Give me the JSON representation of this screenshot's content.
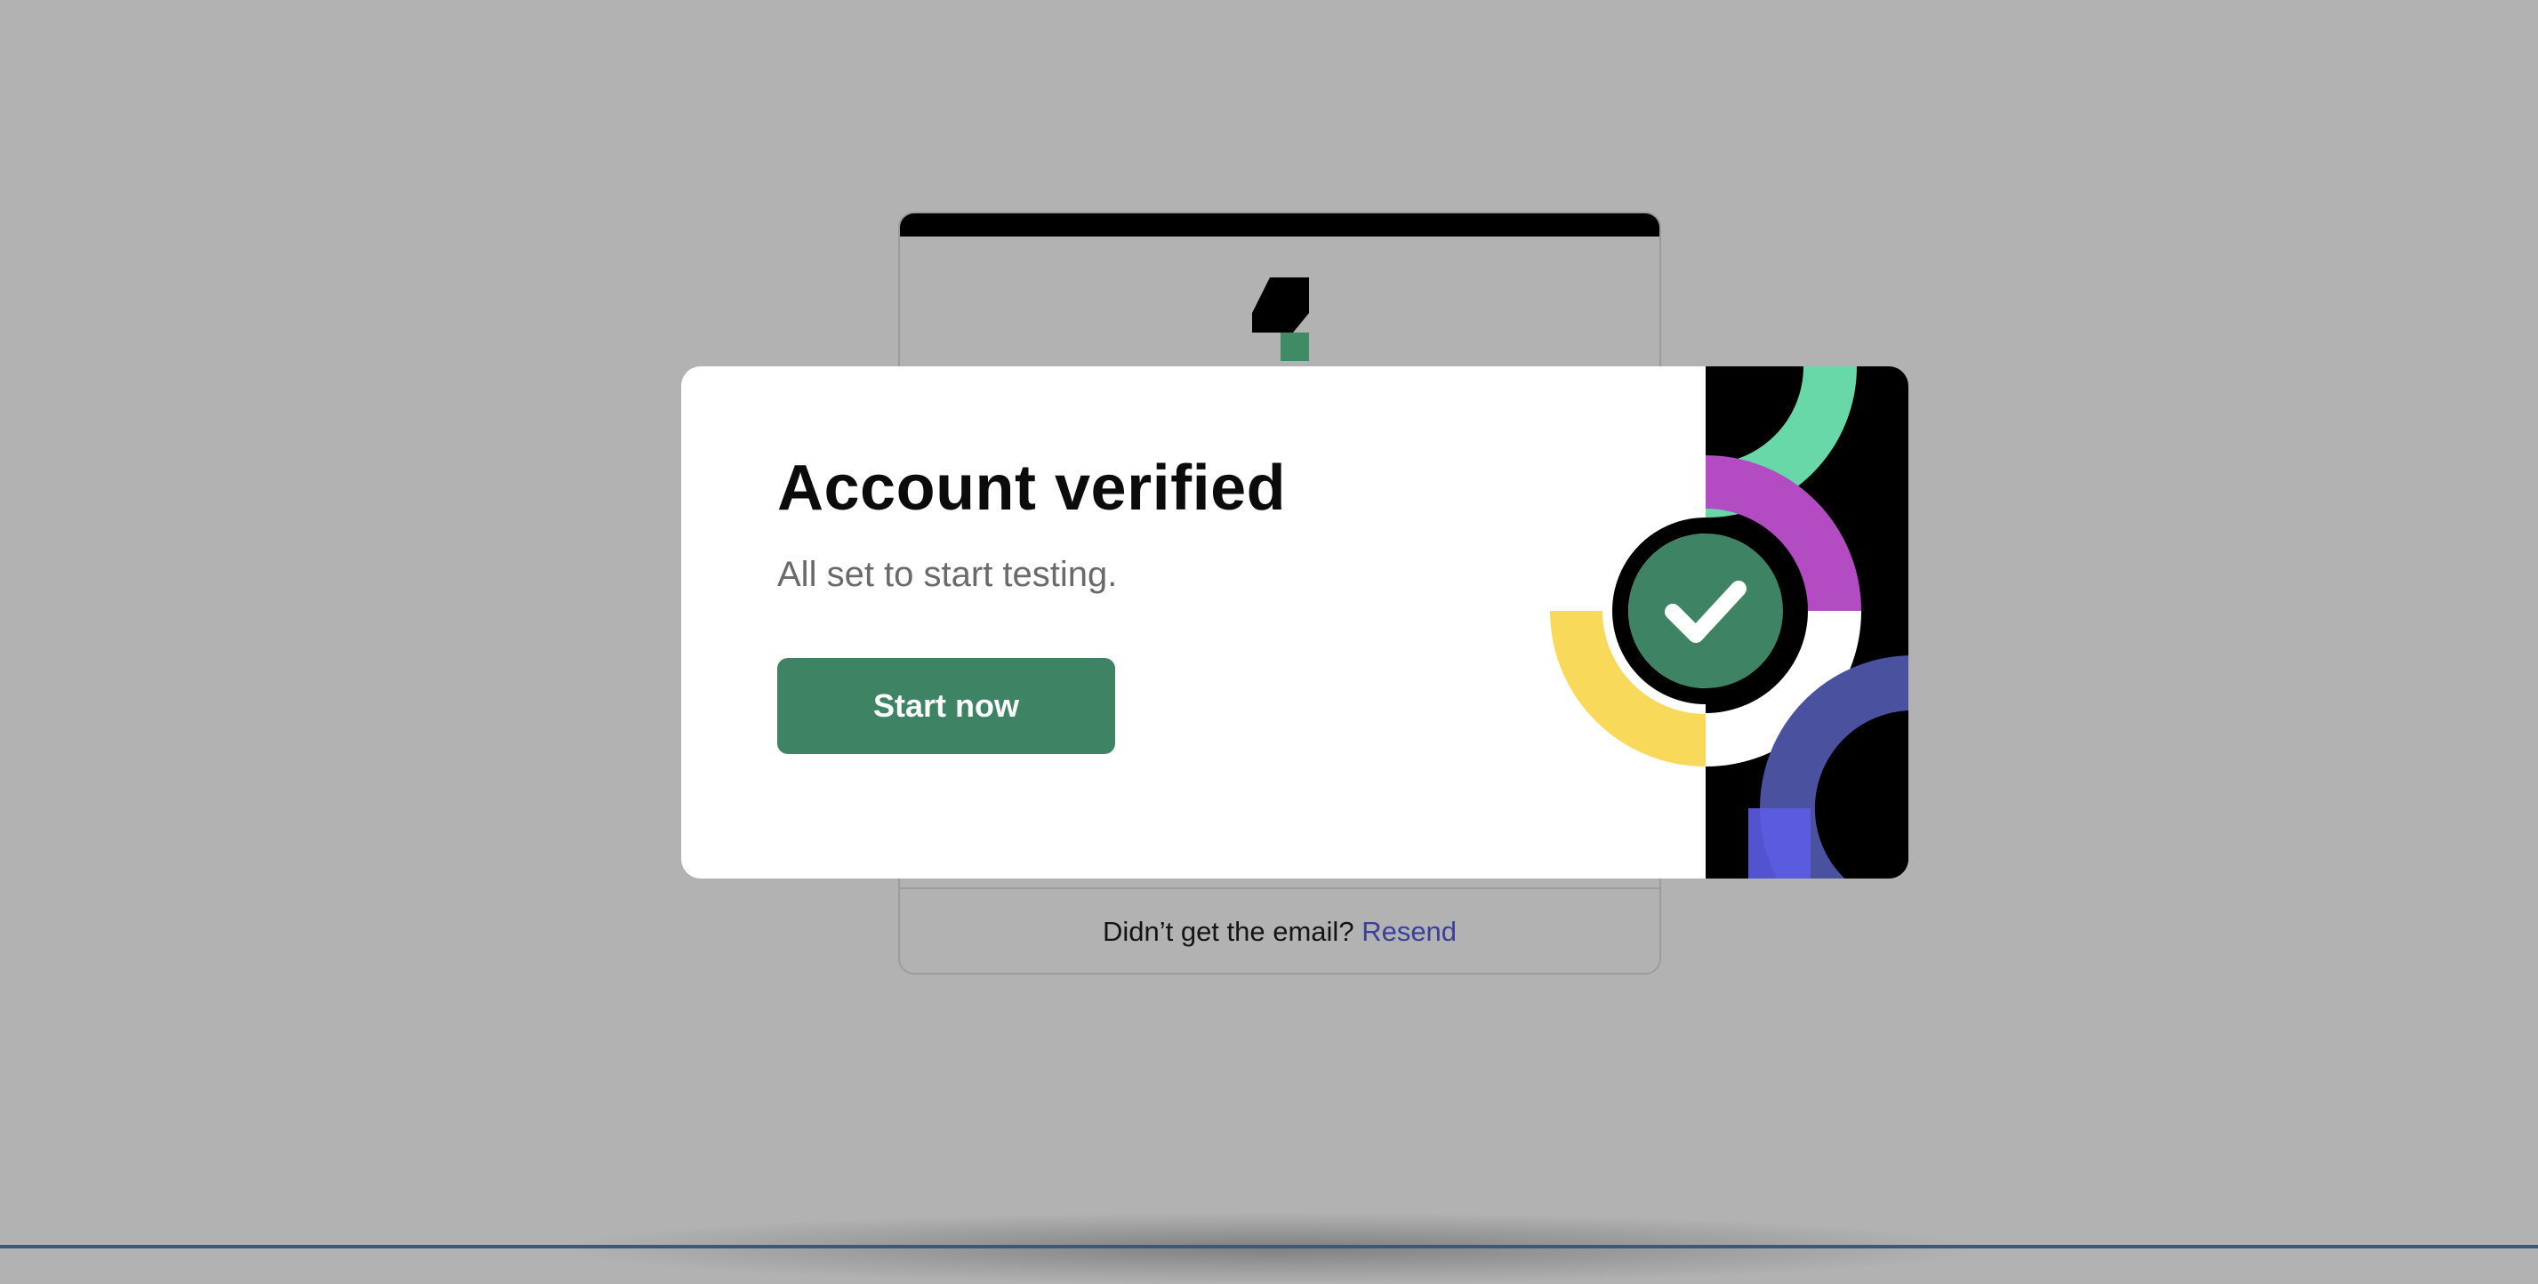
{
  "background_card": {
    "footer_text": "Didn’t get the email?",
    "footer_link": "Resend"
  },
  "modal": {
    "title": "Account verified",
    "subtitle": "All set to start testing.",
    "button_label": "Start now"
  },
  "icons": {
    "logo": "brand-logo-icon",
    "success": "checkmark-icon"
  },
  "colors": {
    "overlay": "#b2b2b2",
    "primary_button": "#3e8464",
    "link": "#3a3f9a",
    "art_mint": "#68d8a8",
    "art_purple": "#b34bc2",
    "art_yellow": "#f8d95a",
    "art_indigo": "#4a519e",
    "art_violet": "#5c5ce6"
  }
}
